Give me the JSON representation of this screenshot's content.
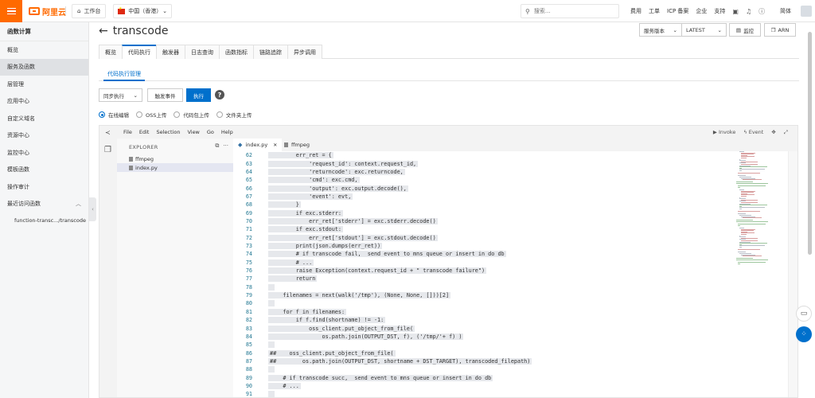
{
  "topbar": {
    "logo_text": "阿里云",
    "workbench": "工作台",
    "region": "中国（香港）",
    "search_placeholder": "搜索...",
    "nav": [
      "费用",
      "工单",
      "ICP 备案",
      "企业",
      "支持"
    ],
    "language": "简体"
  },
  "sidebar": {
    "title": "函数计算",
    "items": [
      {
        "label": "概览",
        "active": false
      },
      {
        "label": "服务及函数",
        "active": true
      },
      {
        "label": "层管理",
        "active": false
      },
      {
        "label": "应用中心",
        "active": false
      },
      {
        "label": "自定义域名",
        "active": false
      },
      {
        "label": "资源中心",
        "active": false
      },
      {
        "label": "监控中心",
        "active": false
      },
      {
        "label": "模板函数",
        "active": false
      },
      {
        "label": "操作审计",
        "active": false
      },
      {
        "label": "最近访问函数",
        "active": false
      }
    ],
    "recent": [
      "function-transc.../transcode"
    ]
  },
  "header": {
    "title": "transcode",
    "version_select": "服务版本",
    "version_value": "LATEST",
    "monitor_btn": "监控",
    "arn_btn": "ARN"
  },
  "tabs": [
    "概览",
    "代码执行",
    "触发器",
    "日志查询",
    "函数指标",
    "链路追踪",
    "异步调用"
  ],
  "active_tab": 1,
  "subtab": "代码执行管理",
  "actions": {
    "mode_select": "同步执行",
    "trigger_event": "触发事件",
    "execute": "执行"
  },
  "radios": [
    {
      "label": "在线编辑",
      "checked": true
    },
    {
      "label": "OSS上传",
      "checked": false
    },
    {
      "label": "代码包上传",
      "checked": false
    },
    {
      "label": "文件夹上传",
      "checked": false
    }
  ],
  "ide": {
    "menu": [
      "File",
      "Edit",
      "Selection",
      "View",
      "Go",
      "Help"
    ],
    "invoke": "Invoke",
    "event": "Event",
    "explorer_title": "EXPLORER",
    "files": [
      "ffmpeg",
      "index.py"
    ],
    "selected_file": "index.py",
    "editor_tabs": [
      "index.py",
      "ffmpeg"
    ],
    "code": [
      {
        "n": "62",
        "t": "        err_ret = {",
        "hl": true
      },
      {
        "n": "63",
        "t": "            'request_id': context.request_id,",
        "hl": true
      },
      {
        "n": "64",
        "t": "            'returncode': exc.returncode,",
        "hl": true
      },
      {
        "n": "65",
        "t": "            'cmd': exc.cmd,",
        "hl": true
      },
      {
        "n": "66",
        "t": "            'output': exc.output.decode(),",
        "hl": true
      },
      {
        "n": "67",
        "t": "            'event': evt,",
        "hl": true
      },
      {
        "n": "68",
        "t": "        }",
        "hl": true
      },
      {
        "n": "69",
        "t": "        if exc.stderr:",
        "hl": true
      },
      {
        "n": "70",
        "t": "            err_ret['stderr'] = exc.stderr.decode()",
        "hl": true
      },
      {
        "n": "71",
        "t": "        if exc.stdout:",
        "hl": true
      },
      {
        "n": "72",
        "t": "            err_ret['stdout'] = exc.stdout.decode()",
        "hl": true
      },
      {
        "n": "73",
        "t": "        print(json.dumps(err_ret))",
        "hl": true
      },
      {
        "n": "74",
        "t": "        # if transcode fail,  send event to mns queue or insert in do db",
        "hl": true
      },
      {
        "n": "75",
        "t": "        # ...",
        "hl": true
      },
      {
        "n": "76",
        "t": "        raise Exception(context.request_id + \" transcode failure\")",
        "hl": true
      },
      {
        "n": "77",
        "t": "        return",
        "hl": true
      },
      {
        "n": "78",
        "t": "",
        "hl": true
      },
      {
        "n": "79",
        "t": "    filenames = next(walk('/tmp'), (None, None, []))[2]",
        "hl": true
      },
      {
        "n": "80",
        "t": "",
        "hl": true
      },
      {
        "n": "81",
        "t": "    for f in filenames:",
        "hl": true
      },
      {
        "n": "82",
        "t": "        if f.find(shortname) != -1:",
        "hl": true
      },
      {
        "n": "83",
        "t": "            oss_client.put_object_from_file(",
        "hl": true
      },
      {
        "n": "84",
        "t": "                os.path.join(OUTPUT_DST, f), ('/tmp/'+ f) )",
        "hl": true
      },
      {
        "n": "85",
        "t": "",
        "hl": true
      },
      {
        "n": "86",
        "t": "##    oss_client.put_object_from_file(",
        "hl": true
      },
      {
        "n": "87",
        "t": "##        os.path.join(OUTPUT_DST, shortname + DST_TARGET), transcoded_filepath)",
        "hl": true
      },
      {
        "n": "88",
        "t": "",
        "hl": true
      },
      {
        "n": "89",
        "t": "    # if transcode succ,  send event to mns queue or insert in do db",
        "hl": true
      },
      {
        "n": "90",
        "t": "    # ...",
        "hl": true
      },
      {
        "n": "91",
        "t": "",
        "hl": true
      }
    ]
  },
  "colors": {
    "brand": "#ff6a00",
    "primary": "#0070cc",
    "code_highlight": "#e6e8ec"
  }
}
